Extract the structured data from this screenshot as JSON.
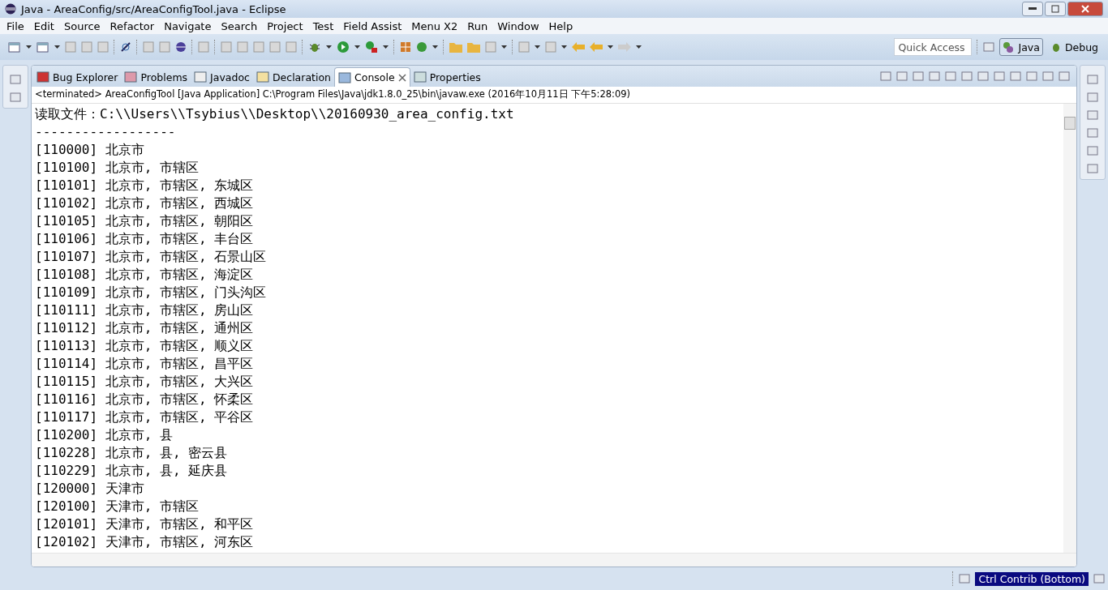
{
  "window": {
    "title": "Java - AreaConfig/src/AreaConfigTool.java - Eclipse"
  },
  "menu": [
    "File",
    "Edit",
    "Source",
    "Refactor",
    "Navigate",
    "Search",
    "Project",
    "Test",
    "Field Assist",
    "Menu X2",
    "Run",
    "Window",
    "Help"
  ],
  "quick_access": {
    "placeholder": "Quick Access"
  },
  "perspectives": [
    {
      "label": "Java",
      "selected": true
    },
    {
      "label": "Debug",
      "selected": false
    }
  ],
  "tabs": [
    {
      "label": "Bug Explorer",
      "selected": false
    },
    {
      "label": "Problems",
      "selected": false
    },
    {
      "label": "Javadoc",
      "selected": false
    },
    {
      "label": "Declaration",
      "selected": false
    },
    {
      "label": "Console",
      "selected": true
    },
    {
      "label": "Properties",
      "selected": false
    }
  ],
  "console": {
    "description": "<terminated> AreaConfigTool [Java Application] C:\\Program Files\\Java\\jdk1.8.0_25\\bin\\javaw.exe (2016年10月11日 下午5:28:09)",
    "lines": [
      "读取文件：C:\\\\Users\\\\Tsybius\\\\Desktop\\\\20160930_area_config.txt",
      "------------------",
      "[110000] 北京市",
      "[110100] 北京市, 市辖区",
      "[110101] 北京市, 市辖区, 东城区",
      "[110102] 北京市, 市辖区, 西城区",
      "[110105] 北京市, 市辖区, 朝阳区",
      "[110106] 北京市, 市辖区, 丰台区",
      "[110107] 北京市, 市辖区, 石景山区",
      "[110108] 北京市, 市辖区, 海淀区",
      "[110109] 北京市, 市辖区, 门头沟区",
      "[110111] 北京市, 市辖区, 房山区",
      "[110112] 北京市, 市辖区, 通州区",
      "[110113] 北京市, 市辖区, 顺义区",
      "[110114] 北京市, 市辖区, 昌平区",
      "[110115] 北京市, 市辖区, 大兴区",
      "[110116] 北京市, 市辖区, 怀柔区",
      "[110117] 北京市, 市辖区, 平谷区",
      "[110200] 北京市, 县",
      "[110228] 北京市, 县, 密云县",
      "[110229] 北京市, 县, 延庆县",
      "[120000] 天津市",
      "[120100] 天津市, 市辖区",
      "[120101] 天津市, 市辖区, 和平区",
      "[120102] 天津市, 市辖区, 河东区"
    ]
  },
  "status_bar": {
    "contribution": "Ctrl Contrib (Bottom)"
  }
}
